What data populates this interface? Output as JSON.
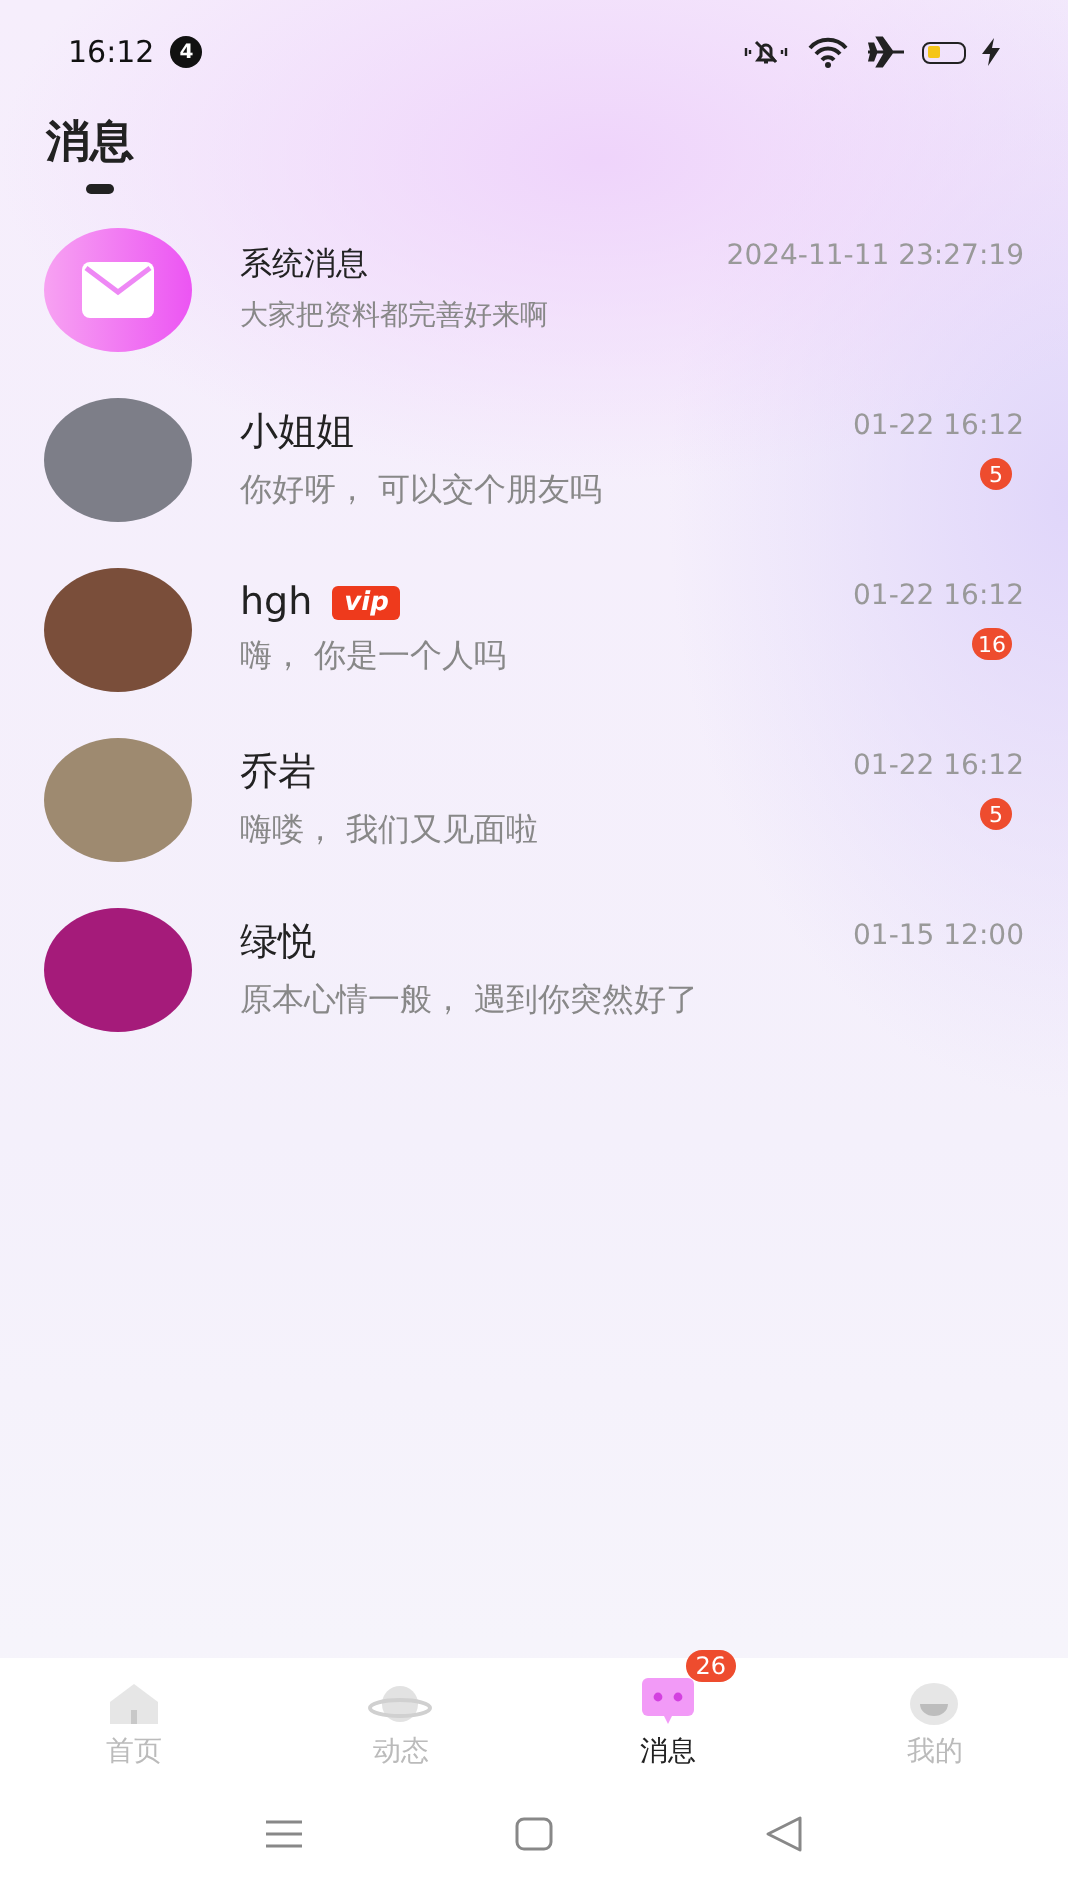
{
  "status_bar": {
    "time": "16:12",
    "notification_count": "4"
  },
  "header": {
    "title": "消息"
  },
  "conversations": [
    {
      "kind": "system",
      "name": "系统消息",
      "preview": "大家把资料都完善好来啊",
      "time": "2024-11-11 23:27:19"
    },
    {
      "kind": "photo",
      "name": "小姐姐",
      "preview": "你好呀， 可以交个朋友吗",
      "time": "01-22 16:12",
      "unread": "5"
    },
    {
      "kind": "photo",
      "name": "hgh",
      "vip": "vip",
      "preview": "嗨， 你是一个人吗",
      "time": "01-22 16:12",
      "unread": "16"
    },
    {
      "kind": "photo",
      "name": "乔岩",
      "preview": "嗨喽， 我们又见面啦",
      "time": "01-22 16:12",
      "unread": "5"
    },
    {
      "kind": "photo",
      "name": "绿悦",
      "preview": "原本心情一般， 遇到你突然好了",
      "time": "01-15 12:00"
    }
  ],
  "tab_bar": [
    {
      "kind": "home",
      "label": "首页",
      "selected": false
    },
    {
      "kind": "planet",
      "label": "动态",
      "selected": false
    },
    {
      "kind": "chat",
      "label": "消息",
      "selected": true,
      "badge": "26"
    },
    {
      "kind": "face",
      "label": "我的",
      "selected": false
    }
  ]
}
